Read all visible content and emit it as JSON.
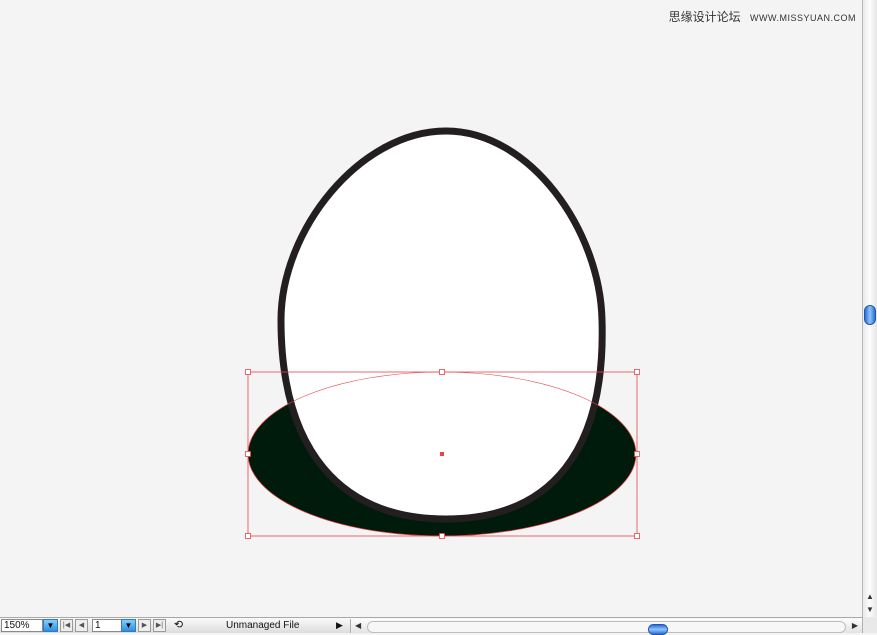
{
  "watermark": {
    "site_name": "思缘设计论坛",
    "site_url": "WWW.MISSYUAN.COM"
  },
  "colors": {
    "canvas": "#f4f4f4",
    "body_fill": "#ffffff",
    "body_stroke": "#231f20",
    "shadow_fill": "#001a0c",
    "selection": "#e8444a",
    "scroll_thumb": "#2a6fd6"
  },
  "status_bar": {
    "zoom_value": "150%",
    "artboard_value": "1",
    "status_text": "Unmanaged File",
    "icons": {
      "zoom_dropdown": "chevron-down-icon",
      "first": "first-icon",
      "prev": "previous-icon",
      "next": "next-icon",
      "last": "last-icon",
      "revert": "revert-icon",
      "menu": "play-icon"
    }
  }
}
